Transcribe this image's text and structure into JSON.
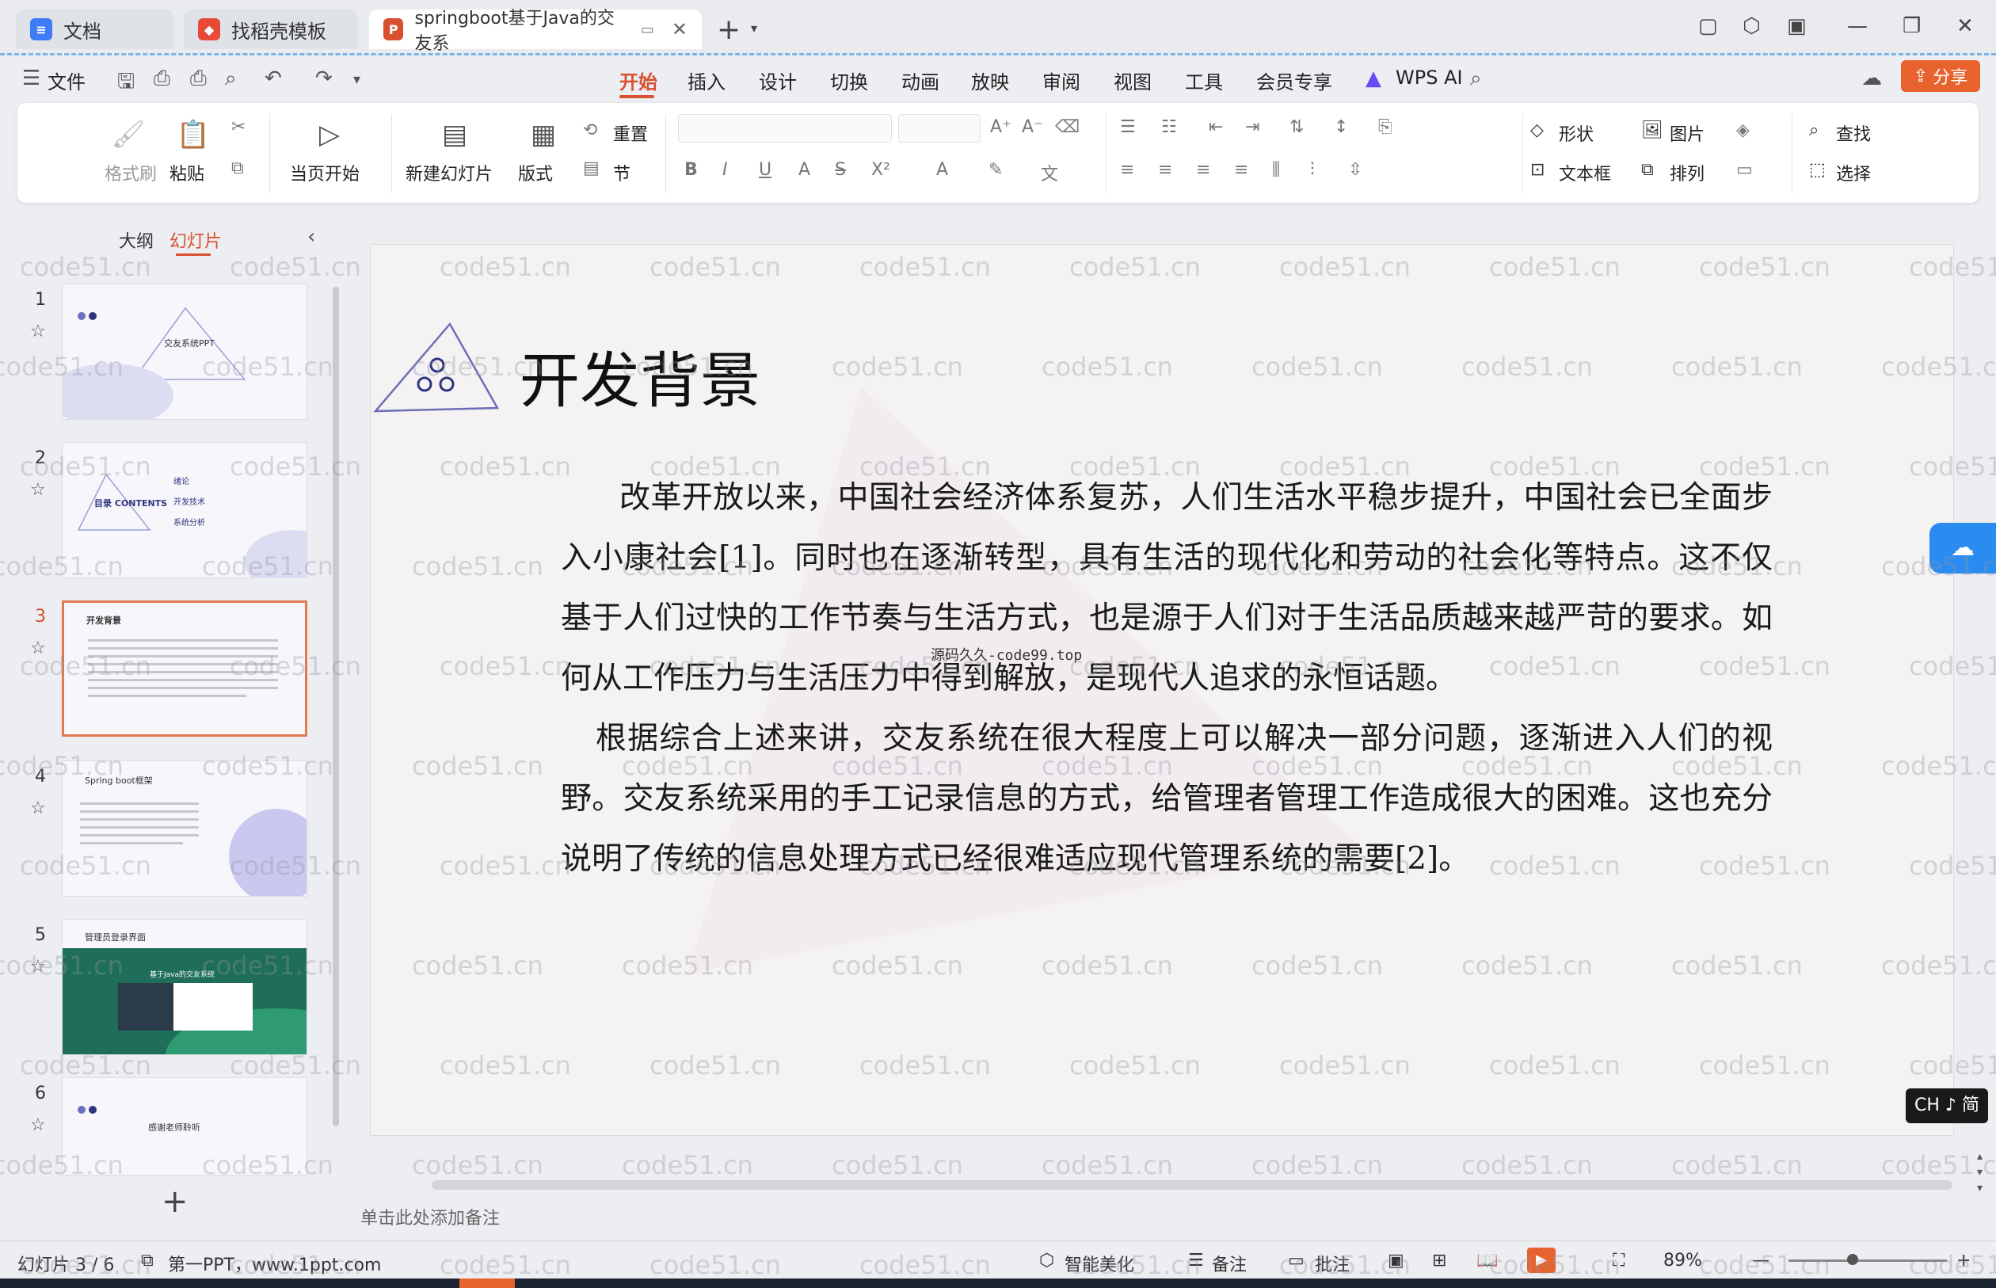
{
  "tabs": [
    {
      "icon": "docs-icon",
      "label": "文档",
      "color": "#3d7bf7"
    },
    {
      "icon": "template-icon",
      "label": "找稻壳模板",
      "color": "#e84a3a"
    },
    {
      "icon": "ppt-icon",
      "label": "springboot基于Java的交友系",
      "color": "#d9502f"
    }
  ],
  "menu": {
    "file": "文件",
    "items": [
      "开始",
      "插入",
      "设计",
      "切换",
      "动画",
      "放映",
      "审阅",
      "视图",
      "工具",
      "会员专享"
    ],
    "wps_ai": "WPS AI",
    "share": "分享"
  },
  "ribbon": {
    "format_painter": "格式刷",
    "paste": "粘贴",
    "start_from_current": "当页开始",
    "new_slide": "新建幻灯片",
    "layout": "版式",
    "reset": "重置",
    "section": "节",
    "shape": "形状",
    "picture": "图片",
    "find": "查找",
    "textbox": "文本框",
    "arrange": "排列",
    "select": "选择"
  },
  "left_panel": {
    "tab_outline": "大纲",
    "tab_slides": "幻灯片",
    "thumbnails": [
      {
        "num": "1",
        "title": "交友系统PPT"
      },
      {
        "num": "2",
        "title": "目录 CONTENTS",
        "items": [
          "绪论",
          "开发技术",
          "系统分析"
        ]
      },
      {
        "num": "3",
        "title": "开发背景"
      },
      {
        "num": "4",
        "title": "Spring boot框架"
      },
      {
        "num": "5",
        "title": "管理员登录界面",
        "subtitle": "基于Java的交友系统"
      },
      {
        "num": "6",
        "title": "感谢老师聆听"
      }
    ],
    "current": 3
  },
  "slide": {
    "title": "开发背景",
    "paragraphs": [
      "改革开放以来，中国社会经济体系复苏，人们生活水平稳步提升，中国社会已全面步入小康社会[1]。同时也在逐渐转型，具有生活的现代化和劳动的社会化等特点。这不仅基于人们过快的工作节奏与生活方式，也是源于人们对于生活品质越来越严苛的要求。如何从工作压力与生活压力中得到解放，是现代人追求的永恒话题。",
      "根据综合上述来讲，交友系统在很大程度上可以解决一部分问题，逐渐进入人们的视野。交友系统采用的手工记录信息的方式，给管理者管理工作造成很大的困难。这也充分说明了传统的信息处理方式已经很难适应现代管理系统的需要[2]。"
    ],
    "source_mark": "源码久久-code99.top"
  },
  "watermark_text": "code51.cn",
  "notes_placeholder": "单击此处添加备注",
  "status": {
    "slide_counter": "幻灯片 3 / 6",
    "theme": "第一PPT，www.1ppt.com",
    "beautify": "智能美化",
    "notes": "备注",
    "comments": "批注",
    "zoom": "89%"
  },
  "ime": "CH ♪ 简"
}
